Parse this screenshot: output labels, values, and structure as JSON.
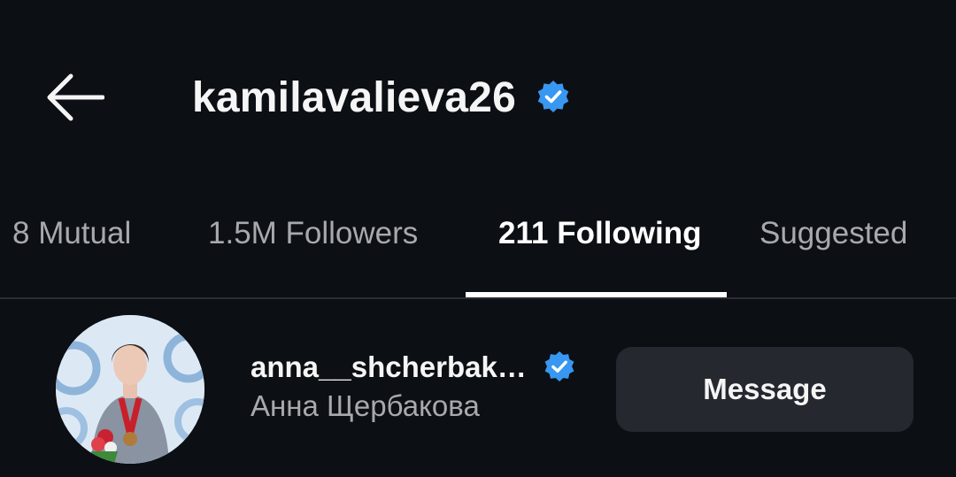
{
  "header": {
    "back_icon": "arrow-left-icon",
    "username": "kamilavalieva26",
    "verified_icon": "verified-badge-icon",
    "verified_color": "#3897f0"
  },
  "tabs": [
    {
      "label": "8 Mutual",
      "active": false
    },
    {
      "label": "1.5M Followers",
      "active": false
    },
    {
      "label": "211 Following",
      "active": true
    },
    {
      "label": "Suggested",
      "active": false
    }
  ],
  "list": [
    {
      "handle": "anna__shcherbak…",
      "full_name": "Анна Щербакова",
      "verified": true,
      "avatar_icon": "profile-photo",
      "action_label": "Message"
    }
  ],
  "colors": {
    "background": "#0c0f14",
    "text_primary": "#f5f5f5",
    "text_secondary": "#a8a9ad",
    "button_bg": "#25282e",
    "accent": "#3897f0"
  }
}
